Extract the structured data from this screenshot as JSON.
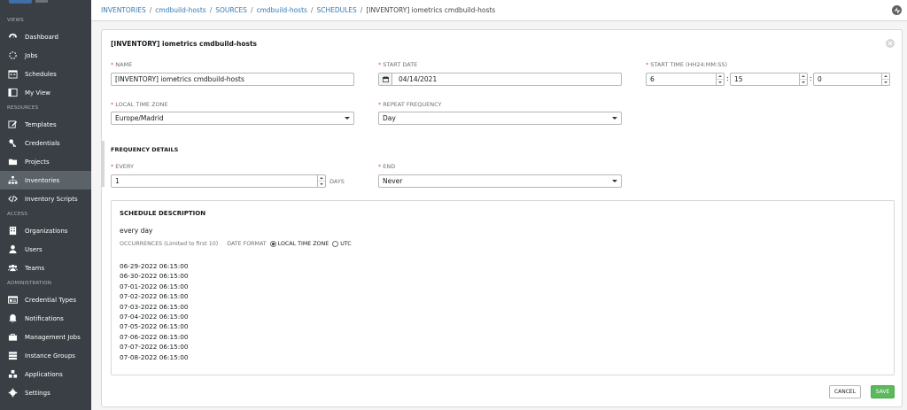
{
  "sidebar": {
    "sections": [
      {
        "label": "VIEWS",
        "items": [
          {
            "label": "Dashboard",
            "icon": "dashboard-icon"
          },
          {
            "label": "Jobs",
            "icon": "jobs-icon"
          },
          {
            "label": "Schedules",
            "icon": "calendar-icon"
          },
          {
            "label": "My View",
            "icon": "my-view-icon"
          }
        ]
      },
      {
        "label": "RESOURCES",
        "items": [
          {
            "label": "Templates",
            "icon": "pencil-icon"
          },
          {
            "label": "Credentials",
            "icon": "key-icon"
          },
          {
            "label": "Projects",
            "icon": "folder-icon"
          },
          {
            "label": "Inventories",
            "icon": "sitemap-icon"
          },
          {
            "label": "Inventory Scripts",
            "icon": "code-icon"
          }
        ]
      },
      {
        "label": "ACCESS",
        "items": [
          {
            "label": "Organizations",
            "icon": "building-icon"
          },
          {
            "label": "Users",
            "icon": "user-icon"
          },
          {
            "label": "Teams",
            "icon": "team-icon"
          }
        ]
      },
      {
        "label": "ADMINISTRATION",
        "items": [
          {
            "label": "Credential Types",
            "icon": "id-card-icon"
          },
          {
            "label": "Notifications",
            "icon": "bell-icon"
          },
          {
            "label": "Management Jobs",
            "icon": "briefcase-icon"
          },
          {
            "label": "Instance Groups",
            "icon": "server-icon"
          },
          {
            "label": "Applications",
            "icon": "cubes-icon"
          },
          {
            "label": "Settings",
            "icon": "gear-icon"
          }
        ]
      }
    ],
    "active_item": "Inventories"
  },
  "breadcrumb": {
    "items": [
      "INVENTORIES",
      "cmdbuild-hosts",
      "SOURCES",
      "cmdbuild-hosts",
      "SCHEDULES"
    ],
    "current": "[INVENTORY] iometrics cmdbuild-hosts",
    "separator": "/"
  },
  "form": {
    "title": "[INVENTORY] iometrics cmdbuild-hosts",
    "name_label": "NAME",
    "name_value": "[INVENTORY] iometrics cmdbuild-hosts",
    "start_date_label": "START DATE",
    "start_date_value": "04/14/2021",
    "start_time_label": "START TIME (HH24:MM:SS)",
    "start_time_hh": "6",
    "start_time_mm": "15",
    "start_time_ss": "0",
    "time_colon": ":",
    "timezone_label": "LOCAL TIME ZONE",
    "timezone_value": "Europe/Madrid",
    "repeat_label": "REPEAT FREQUENCY",
    "repeat_value": "Day",
    "required_mark": "*"
  },
  "frequency": {
    "heading": "FREQUENCY DETAILS",
    "every_label": "EVERY",
    "every_value": "1",
    "every_unit": "DAYS",
    "end_label": "END",
    "end_value": "Never"
  },
  "description": {
    "heading": "SCHEDULE DESCRIPTION",
    "text": "every day",
    "occurrences_label": "OCCURRENCES (Limited to first 10)",
    "date_format_label": "DATE FORMAT",
    "option_local": "LOCAL TIME ZONE",
    "option_utc": "UTC",
    "selected_format": "LOCAL TIME ZONE",
    "occurrences": [
      "06-29-2022 06:15:00",
      "06-30-2022 06:15:00",
      "07-01-2022 06:15:00",
      "07-02-2022 06:15:00",
      "07-03-2022 06:15:00",
      "07-04-2022 06:15:00",
      "07-05-2022 06:15:00",
      "07-06-2022 06:15:00",
      "07-07-2022 06:15:00",
      "07-08-2022 06:15:00"
    ]
  },
  "actions": {
    "cancel_label": "CANCEL",
    "save_label": "SAVE"
  },
  "colors": {
    "sidebar_bg": "#393f44",
    "link": "#337ab7",
    "save": "#5cb85c",
    "required": "#d9534f"
  }
}
